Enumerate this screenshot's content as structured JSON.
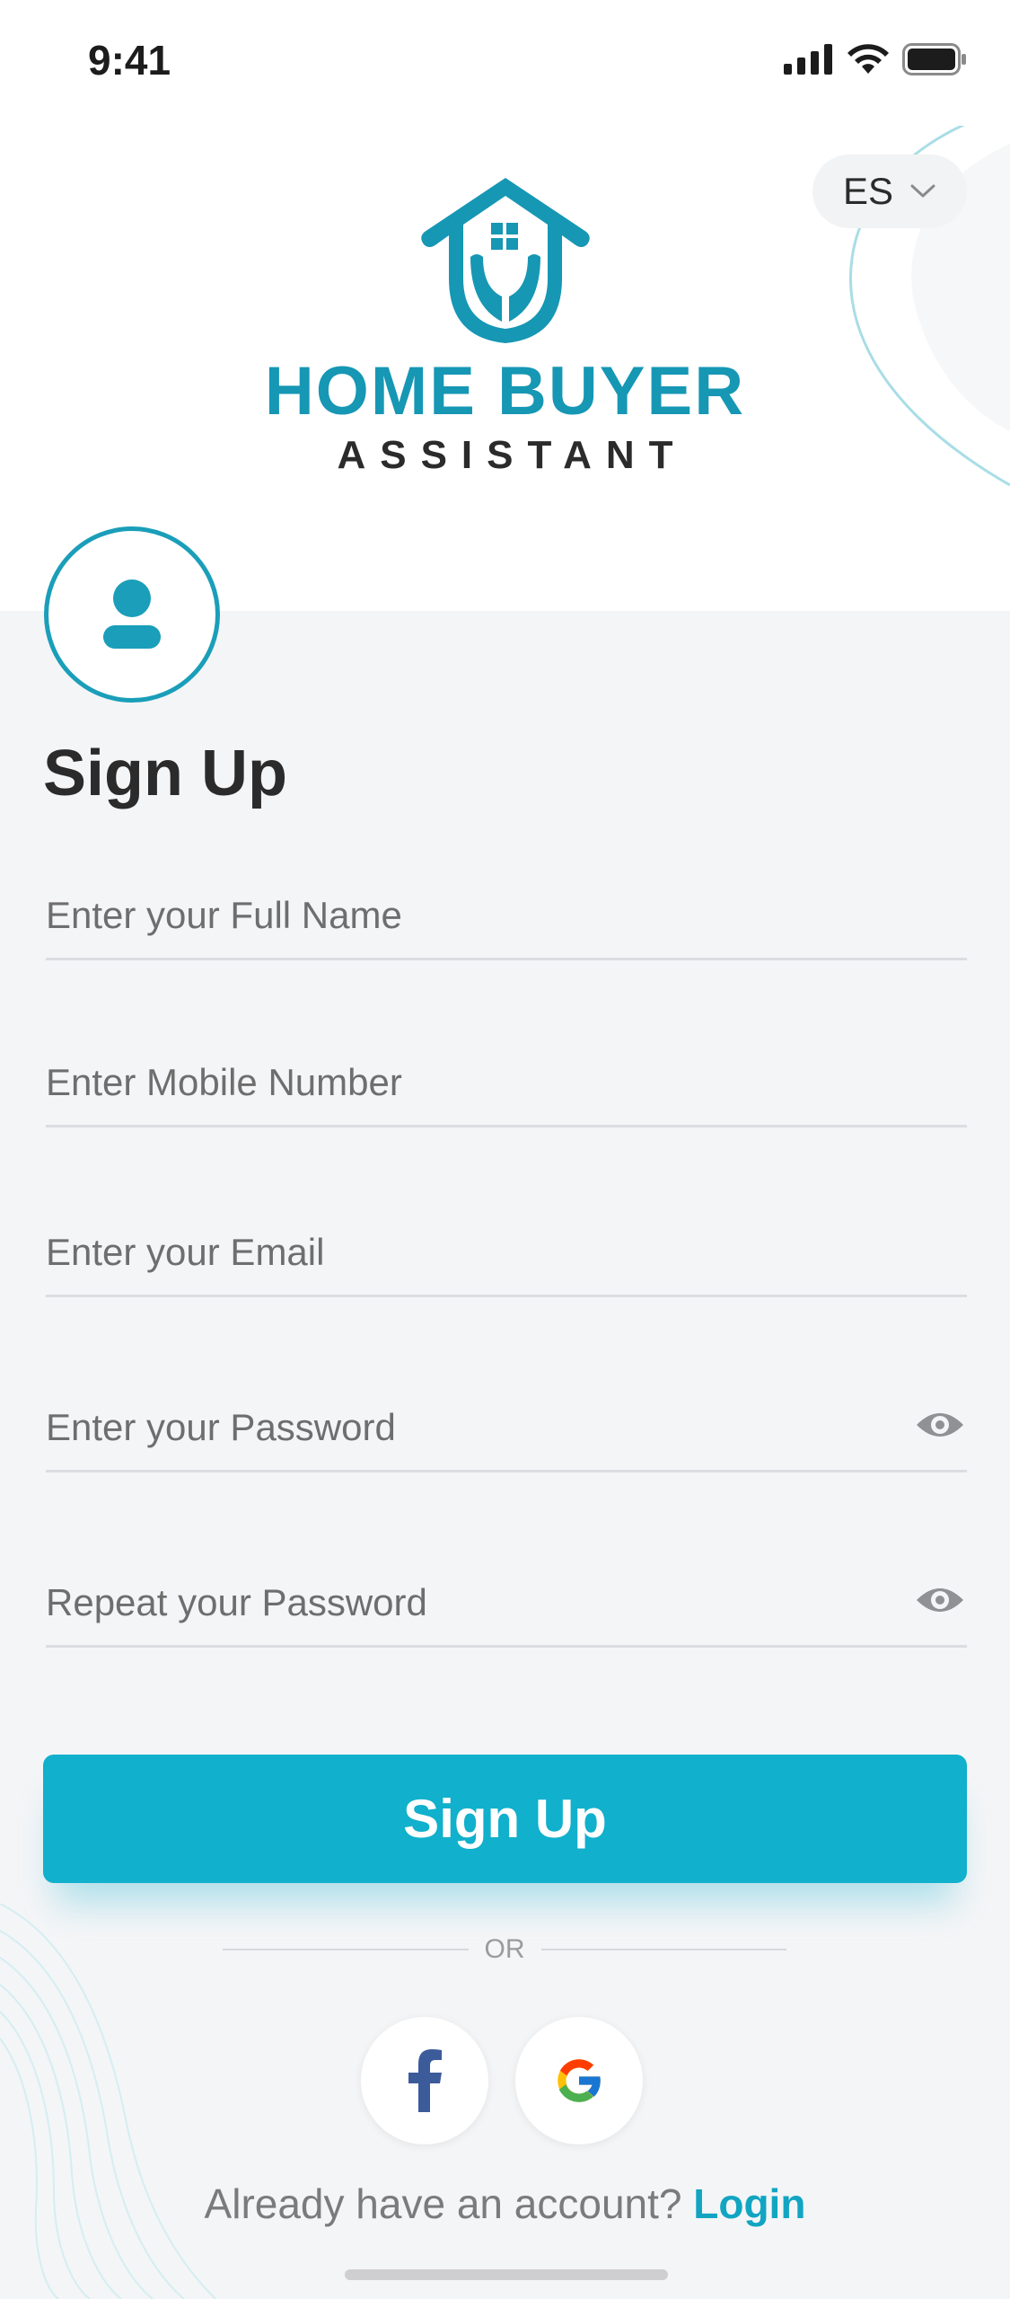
{
  "status_bar": {
    "time": "9:41"
  },
  "language": {
    "selected": "ES"
  },
  "brand": {
    "title": "HOME BUYER",
    "subtitle": "ASSISTANT"
  },
  "form": {
    "title": "Sign Up",
    "fields": [
      {
        "placeholder": "Enter your Full Name",
        "value": ""
      },
      {
        "placeholder": "Enter Mobile Number",
        "value": ""
      },
      {
        "placeholder": "Enter your Email",
        "value": ""
      },
      {
        "placeholder": "Enter your Password",
        "value": ""
      },
      {
        "placeholder": "Repeat your Password",
        "value": ""
      }
    ],
    "submit_label": "Sign Up",
    "divider_text": "OR"
  },
  "social": {
    "facebook_icon": "facebook-icon",
    "google_icon": "google-icon"
  },
  "footer": {
    "prompt": "Already have an account?",
    "login_label": "Login"
  },
  "colors": {
    "accent": "#11b0cc",
    "brand": "#1697b4",
    "text": "#2b2b2b",
    "background": "#f4f5f7"
  }
}
